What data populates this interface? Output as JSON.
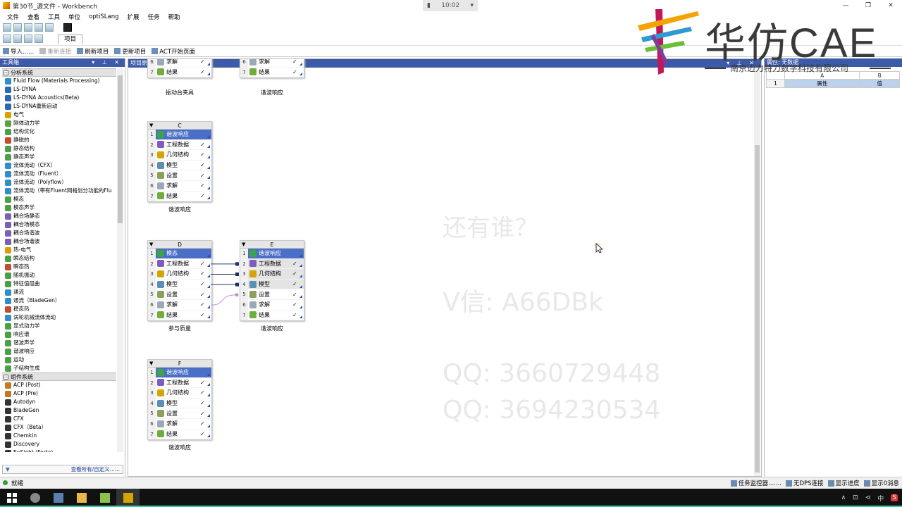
{
  "window": {
    "title": "第30节_源文件 - Workbench",
    "clock": "10:02",
    "controls": [
      "—",
      "❐",
      "✕"
    ]
  },
  "menu": [
    "文件",
    "查看",
    "工具",
    "单位",
    "optiSLang",
    "扩展",
    "任务",
    "帮助"
  ],
  "toolbar": {
    "project_tab": "项目"
  },
  "actions": [
    {
      "label": "导入......",
      "enabled": true
    },
    {
      "label": "重新连接",
      "enabled": false
    },
    {
      "label": "刷新项目",
      "enabled": true
    },
    {
      "label": "更新项目",
      "enabled": true
    },
    {
      "label": "ACT开始页面",
      "enabled": true
    }
  ],
  "toolbox": {
    "title": "工具箱",
    "pins": "▾ ⊥ ✕",
    "group_analysis": "分析系统",
    "analysis_items": [
      {
        "label": "Fluid Flow (Materials Processing)",
        "color": "#2f8ec8"
      },
      {
        "label": "LS-DYNA",
        "color": "#2a6ab0"
      },
      {
        "label": "LS-DYNA Acoustics(Beta)",
        "color": "#2a6ab0"
      },
      {
        "label": "LS-DYNA重新启动",
        "color": "#2a6ab0"
      },
      {
        "label": "电气",
        "color": "#d9a100"
      },
      {
        "label": "刚体动力学",
        "color": "#5aa33a"
      },
      {
        "label": "结构优化",
        "color": "#4b9f45"
      },
      {
        "label": "静磁的",
        "color": "#c24b2c"
      },
      {
        "label": "静态结构",
        "color": "#4b9f45"
      },
      {
        "label": "静态声学",
        "color": "#4b9f45"
      },
      {
        "label": "流体流动（CFX）",
        "color": "#2f8ec8"
      },
      {
        "label": "流体流动（Fluent）",
        "color": "#2f8ec8"
      },
      {
        "label": "流体流动（Polyflow）",
        "color": "#2f8ec8"
      },
      {
        "label": "流体流动（带有Fluent网格划分功能的Flu",
        "color": "#2f8ec8"
      },
      {
        "label": "模态",
        "color": "#4b9f45"
      },
      {
        "label": "模态声学",
        "color": "#4b9f45"
      },
      {
        "label": "耦合场静态",
        "color": "#7a5fb5"
      },
      {
        "label": "耦合场模态",
        "color": "#7a5fb5"
      },
      {
        "label": "耦合场谐波",
        "color": "#7a5fb5"
      },
      {
        "label": "耦合场谐波",
        "color": "#7a5fb5"
      },
      {
        "label": "热-电气",
        "color": "#d9a100"
      },
      {
        "label": "瞬态结构",
        "color": "#4b9f45"
      },
      {
        "label": "瞬态热",
        "color": "#c24b2c"
      },
      {
        "label": "随机振动",
        "color": "#4b9f45"
      },
      {
        "label": "特征值屈曲",
        "color": "#4b9f45"
      },
      {
        "label": "通流",
        "color": "#2f8ec8"
      },
      {
        "label": "通流（BladeGen）",
        "color": "#2f8ec8"
      },
      {
        "label": "稳态热",
        "color": "#c24b2c"
      },
      {
        "label": "涡轮机械流体流动",
        "color": "#2f8ec8"
      },
      {
        "label": "显式动力学",
        "color": "#4b9f45"
      },
      {
        "label": "响应谱",
        "color": "#4b9f45"
      },
      {
        "label": "谐波声学",
        "color": "#4b9f45"
      },
      {
        "label": "谐波响应",
        "color": "#4b9f45"
      },
      {
        "label": "运动",
        "color": "#4b9f45"
      },
      {
        "label": "子结构生成",
        "color": "#4b9f45"
      }
    ],
    "group_component": "组件系统",
    "component_items": [
      {
        "label": "ACP (Post)",
        "color": "#c27a1a"
      },
      {
        "label": "ACP (Pre)",
        "color": "#c27a1a"
      },
      {
        "label": "Autodyn",
        "color": "#333333"
      },
      {
        "label": "BladeGen",
        "color": "#333333"
      },
      {
        "label": "CFX",
        "color": "#333333"
      },
      {
        "label": "CFX（Beta）",
        "color": "#333333"
      },
      {
        "label": "Chemkin",
        "color": "#333333"
      },
      {
        "label": "Discovery",
        "color": "#333333"
      },
      {
        "label": "EnSight (Forte)",
        "color": "#333333"
      }
    ],
    "footer_link": "查看所有/自定义......"
  },
  "schematic": {
    "title": "项目原理图",
    "pins": "▾ ⊥ ✕",
    "systems": [
      {
        "id": "A",
        "rows": [
          {
            "num": "6",
            "label": "求解",
            "state": "✓",
            "icon": "#9aa9b8"
          },
          {
            "num": "7",
            "label": "结果",
            "state": "✓",
            "icon": "#6fae3c"
          }
        ],
        "caption": "振动台夹具"
      },
      {
        "id": "B",
        "rows": [
          {
            "num": "6",
            "label": "求解",
            "state": "✓",
            "icon": "#9aa9b8"
          },
          {
            "num": "7",
            "label": "结果",
            "state": "✓",
            "icon": "#6fae3c"
          }
        ],
        "caption": "谐波响应"
      },
      {
        "id": "C",
        "header": "C",
        "rows": [
          {
            "num": "1",
            "label": "谐波响应",
            "state": "",
            "icon": "#3da34a",
            "hl": true
          },
          {
            "num": "2",
            "label": "工程数据",
            "state": "✓",
            "icon": "#7f5cc2"
          },
          {
            "num": "3",
            "label": "几何结构",
            "state": "✓",
            "icon": "#d6a400"
          },
          {
            "num": "4",
            "label": "模型",
            "state": "✓",
            "icon": "#5b8fb3"
          },
          {
            "num": "5",
            "label": "设置",
            "state": "✓",
            "icon": "#8ca05a"
          },
          {
            "num": "6",
            "label": "求解",
            "state": "✓",
            "icon": "#9aa9b8"
          },
          {
            "num": "7",
            "label": "结果",
            "state": "✓",
            "icon": "#6fae3c"
          }
        ],
        "caption": "谐波响应"
      },
      {
        "id": "D",
        "header": "D",
        "rows": [
          {
            "num": "1",
            "label": "模态",
            "state": "",
            "icon": "#3da34a",
            "hl": true
          },
          {
            "num": "2",
            "label": "工程数据",
            "state": "✓",
            "icon": "#7f5cc2"
          },
          {
            "num": "3",
            "label": "几何结构",
            "state": "✓",
            "icon": "#d6a400"
          },
          {
            "num": "4",
            "label": "模型",
            "state": "✓",
            "icon": "#5b8fb3"
          },
          {
            "num": "5",
            "label": "设置",
            "state": "✓",
            "icon": "#8ca05a"
          },
          {
            "num": "6",
            "label": "求解",
            "state": "✓",
            "icon": "#9aa9b8"
          },
          {
            "num": "7",
            "label": "结果",
            "state": "✓",
            "icon": "#6fae3c"
          }
        ],
        "caption": "参与质量"
      },
      {
        "id": "E",
        "header": "E",
        "rows": [
          {
            "num": "1",
            "label": "谐波响应",
            "state": "",
            "icon": "#3da34a",
            "hl": true
          },
          {
            "num": "2",
            "label": "工程数据",
            "state": "✓",
            "icon": "#7f5cc2",
            "linked": true
          },
          {
            "num": "3",
            "label": "几何结构",
            "state": "✓",
            "icon": "#d6a400",
            "linked": true
          },
          {
            "num": "4",
            "label": "模型",
            "state": "✓",
            "icon": "#5b8fb3",
            "linked": true
          },
          {
            "num": "5",
            "label": "设置",
            "state": "✓",
            "icon": "#8ca05a"
          },
          {
            "num": "6",
            "label": "求解",
            "state": "✓",
            "icon": "#9aa9b8"
          },
          {
            "num": "7",
            "label": "结果",
            "state": "✓",
            "icon": "#6fae3c"
          }
        ],
        "caption": "谐波响应"
      },
      {
        "id": "F",
        "header": "F",
        "rows": [
          {
            "num": "1",
            "label": "谐波响应",
            "state": "",
            "icon": "#3da34a",
            "hl": true
          },
          {
            "num": "2",
            "label": "工程数据",
            "state": "✓",
            "icon": "#7f5cc2"
          },
          {
            "num": "3",
            "label": "几何结构",
            "state": "✓",
            "icon": "#d6a400"
          },
          {
            "num": "4",
            "label": "模型",
            "state": "✓",
            "icon": "#5b8fb3"
          },
          {
            "num": "5",
            "label": "设置",
            "state": "✓",
            "icon": "#8ca05a"
          },
          {
            "num": "6",
            "label": "求解",
            "state": "✓",
            "icon": "#9aa9b8"
          },
          {
            "num": "7",
            "label": "结果",
            "state": "✓",
            "icon": "#6fae3c"
          }
        ],
        "caption": "谐波响应"
      }
    ]
  },
  "properties": {
    "title": "属性: 无数据",
    "col_a": "A",
    "col_b": "B",
    "row_num": "1",
    "row_a": "属性",
    "row_b": "值"
  },
  "watermark": {
    "line1": "还有谁？",
    "line2": "V信: A66DBk",
    "line3": "QQ: 3660729448",
    "line4": "QQ: 3694230534",
    "logo_main": "华仿CAE",
    "logo_sub": "南京迈力特力数字科技有限公司"
  },
  "status": {
    "ready": "就绪",
    "items": [
      "任务监控器.......",
      "无DPS连接",
      "显示进度",
      "显示0消息"
    ]
  },
  "taskbar": {
    "tray": [
      "∧",
      "⊡",
      "⊲",
      "中",
      "S"
    ]
  }
}
